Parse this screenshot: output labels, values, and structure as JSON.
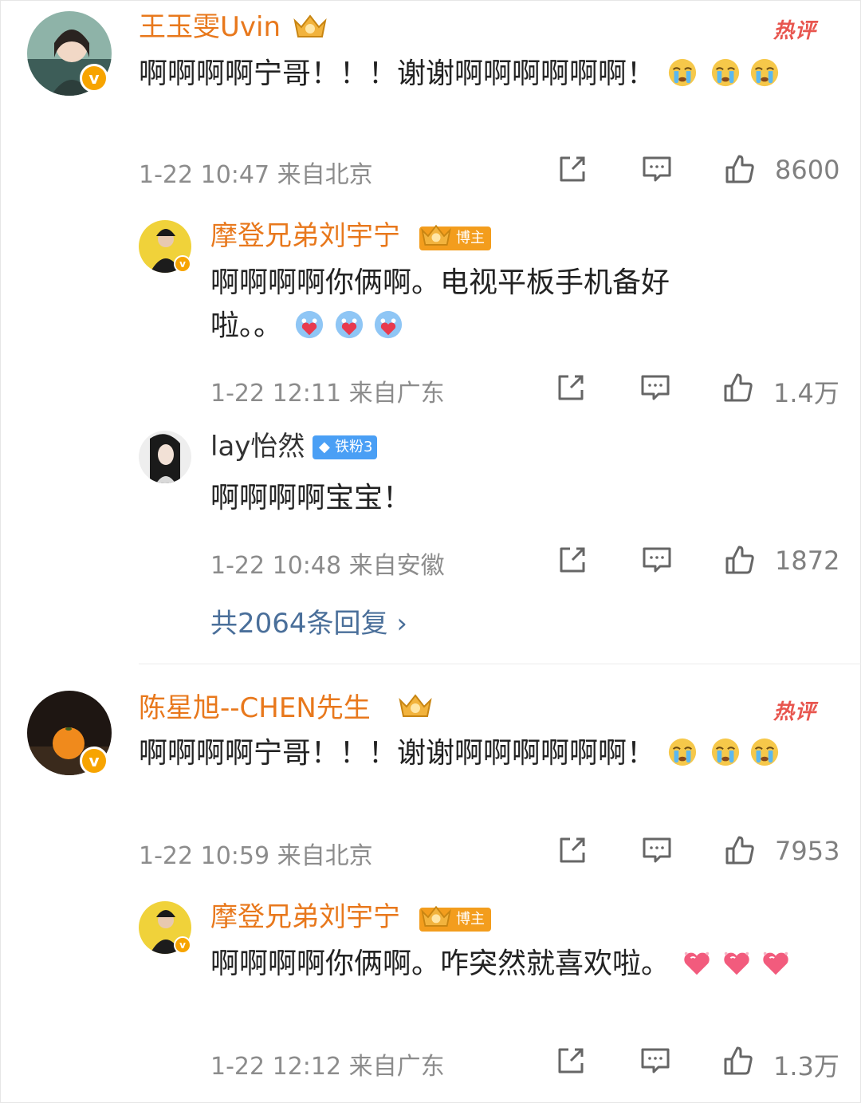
{
  "hot_label": "热评",
  "comments": [
    {
      "user": "王玉雯Uvin",
      "text": "啊啊啊啊宁哥！！！谢谢啊啊啊啊啊啊！",
      "time": "1-22 10:47",
      "location": "来自北京",
      "likes": "8600",
      "emoji": "crying-emoji",
      "reply": {
        "user": "摩登兄弟刘宇宁",
        "tag": "博主",
        "badge_level": "10",
        "text_line1": "啊啊啊啊你俩啊。电视平板手机备好",
        "text_line2": "啦。。",
        "time": "1-22 12:11",
        "location": "来自广东",
        "likes": "1.4万",
        "emoji": "heart-clap-emoji"
      },
      "reply2": {
        "user": "lay怡然",
        "tag": "铁粉3",
        "text": "啊啊啊啊宝宝！",
        "time": "1-22 10:48",
        "location": "来自安徽",
        "likes": "1872"
      },
      "more_replies": "共2064条回复 ›"
    },
    {
      "user": "陈星旭--CHEN先生",
      "text": "啊啊啊啊宁哥！！！谢谢啊啊啊啊啊啊！",
      "time": "1-22 10:59",
      "location": "来自北京",
      "likes": "7953",
      "emoji": "crying-emoji",
      "reply": {
        "user": "摩登兄弟刘宇宁",
        "tag": "博主",
        "badge_level": "10",
        "text": "啊啊啊啊你俩啊。咋突然就喜欢啦。",
        "time": "1-22 12:12",
        "location": "来自广东",
        "likes": "1.3万",
        "emoji": "pink-heart-emoji"
      }
    }
  ],
  "colors": {
    "name_orange": "#e8781c",
    "hot_red": "#e8564f",
    "link_blue": "#4a6f9a",
    "meta_gray": "#8c8c8c",
    "blogger_tag": "#f39d1d",
    "fan_tag": "#4a9ff5"
  }
}
